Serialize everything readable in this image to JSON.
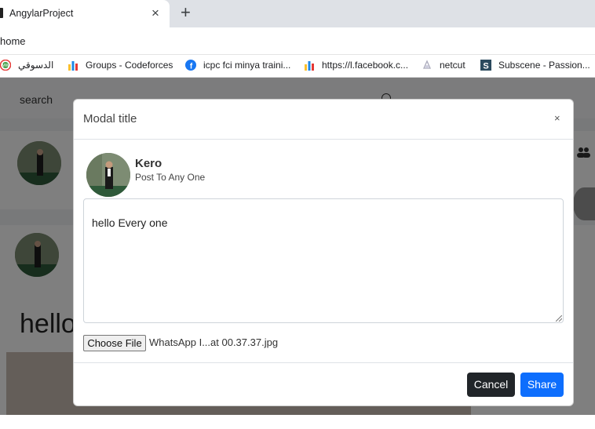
{
  "browser": {
    "tab_title": "AngylarProject",
    "tab_close": "×",
    "new_tab": "+",
    "address": "home",
    "bookmarks": [
      {
        "label": "الدسوقي",
        "icon": "mw-badge-icon"
      },
      {
        "label": "Groups - Codeforces",
        "icon": "codeforces-icon"
      },
      {
        "label": "icpc fci minya traini...",
        "icon": "facebook-icon"
      },
      {
        "label": "https://l.facebook.c...",
        "icon": "bar-chart-icon"
      },
      {
        "label": "netcut",
        "icon": "netcut-icon"
      },
      {
        "label": "Subscene - Passion...",
        "icon": "subscene-icon"
      }
    ]
  },
  "page": {
    "search_placeholder": "search",
    "post_text": "hello"
  },
  "modal": {
    "title": "Modal title",
    "close": "×",
    "user_name": "Kero",
    "user_subtitle": "Post To Any One",
    "post_text": "hello Every one",
    "file_button": "Choose File",
    "file_name": "WhatsApp I...at 00.37.37.jpg",
    "cancel_label": "Cancel",
    "share_label": "Share"
  },
  "colors": {
    "primary": "#0d6efd",
    "dark": "#212529"
  }
}
